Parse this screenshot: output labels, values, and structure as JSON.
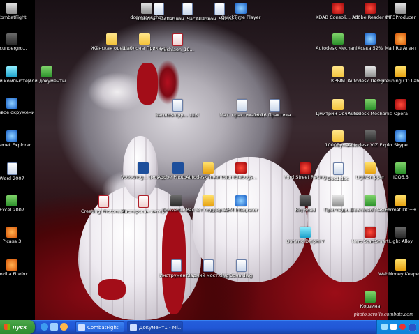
{
  "left_icons": [
    {
      "label": "CombatFight",
      "icon": "combatfight-icon",
      "cls": "i-gray"
    },
    {
      "label": "dcundergro...",
      "icon": "program-icon",
      "cls": "i-dark"
    },
    {
      "label": "Мой компьютер",
      "icon": "computer-icon",
      "cls": "i-cyan"
    },
    {
      "label": "Сетевое окружение",
      "icon": "network-icon",
      "cls": "i-blue"
    },
    {
      "label": "Internet Explorer",
      "icon": "ie-icon",
      "cls": "i-blue"
    },
    {
      "label": "Word 2007",
      "icon": "word-icon",
      "cls": "i-doc"
    },
    {
      "label": "Excel 2007",
      "icon": "excel-icon",
      "cls": "i-green"
    },
    {
      "label": "Picasa 3",
      "icon": "picasa-icon",
      "cls": "i-orange"
    },
    {
      "label": "Mozilla Firefox",
      "icon": "firefox-icon",
      "cls": "i-orange"
    }
  ],
  "middle_icons": [
    {
      "label": "dcdresser.chm",
      "icon": "help-file-icon",
      "cls": "i-gray"
    },
    {
      "label": "Шаблон. Часть 1.avi",
      "icon": "video-file-icon",
      "cls": "i-doc"
    },
    {
      "label": "Шаблон. Часть 2.avi",
      "icon": "video-file-icon",
      "cls": "i-doc"
    },
    {
      "label": "Шаблон. Часть 3.avi",
      "icon": "video-file-icon",
      "cls": "i-doc"
    },
    {
      "label": "QuickTime Player",
      "icon": "quicktime-icon",
      "cls": "i-blue"
    },
    {
      "label": "Мои документы",
      "icon": "my-documents-icon",
      "cls": "i-green"
    },
    {
      "label": "Жёнская одежда",
      "icon": "folder-icon",
      "cls": "i-folder"
    },
    {
      "label": "Шаблоны Приказов",
      "icon": "folder-icon",
      "cls": "i-folder"
    },
    {
      "label": "nuchlaon_19...",
      "icon": "pdf-icon",
      "cls": "i-pdf"
    },
    {
      "label": "NarutoShipp... 115 RusSub...",
      "icon": "video-file-icon",
      "cls": "i-doc"
    },
    {
      "label": "Мат. практика.doc",
      "icon": "word-doc-icon",
      "cls": "i-doc"
    },
    {
      "label": "16.16 Практика...",
      "icon": "word-doc-icon",
      "cls": "i-doc"
    },
    {
      "label": "Vodocnog... (мой диз...",
      "icon": "photoshop-icon",
      "cls": "i-ps"
    },
    {
      "label": "Adobe Photosho...",
      "icon": "photoshop-icon",
      "cls": "i-ps"
    },
    {
      "label": "Autodesk Inventor...",
      "icon": "inventor-icon",
      "cls": "i-yellow"
    },
    {
      "label": "Tumblebugs...",
      "icon": "game-icon",
      "cls": "i-red"
    },
    {
      "label": "Creating Photorealisti...",
      "icon": "pdf-icon",
      "cls": "i-pdf"
    },
    {
      "label": "Мастерская интерьера",
      "icon": "pdf-icon",
      "cls": "i-pdf"
    },
    {
      "label": "ConvertLive",
      "icon": "convert-icon",
      "cls": "i-dark"
    },
    {
      "label": "Расчет поддерж...",
      "icon": "calc-icon",
      "cls": "i-yellow"
    },
    {
      "label": "APM Integrator",
      "icon": "apm-icon",
      "cls": "i-blue"
    },
    {
      "label": "Инструмент...",
      "icon": "dwg-icon",
      "cls": "i-doc"
    },
    {
      "label": "Задний мост.dwg",
      "icon": "dwg-icon",
      "cls": "i-doc"
    },
    {
      "label": "Зона.dwg",
      "icon": "dwg-icon",
      "cls": "i-doc"
    }
  ],
  "right_icons": [
    {
      "label": "KDAB Consoli... 2008",
      "icon": "program-icon",
      "cls": "i-red"
    },
    {
      "label": "Adobe Reader 8",
      "icon": "adobe-reader-icon",
      "cls": "i-red"
    },
    {
      "label": "Autodesk Mechanic...",
      "icon": "autocad-icon",
      "cls": "i-green"
    },
    {
      "label": "Аська 52%",
      "icon": "icq-icon",
      "cls": "i-blue"
    },
    {
      "label": "КРЫМ",
      "icon": "folder-icon",
      "cls": "i-folder"
    },
    {
      "label": "Autodesk Design Review",
      "icon": "autodesk-icon",
      "cls": "i-gray"
    },
    {
      "label": "Дмитрий Овчинников",
      "icon": "folder-icon",
      "cls": "i-folder"
    },
    {
      "label": "Autodesk Mechanical...",
      "icon": "autodesk-icon",
      "cls": "i-green"
    },
    {
      "label": "1000Бумаг",
      "icon": "folder-icon",
      "cls": "i-folder"
    },
    {
      "label": "Autodesk VIZ Explorer 2008",
      "icon": "autodesk-icon",
      "cls": "i-dark"
    },
    {
      "label": "Ford Street Racing",
      "icon": "racing-game-icon",
      "cls": "i-red"
    },
    {
      "label": "Doc1.doc",
      "icon": "word-doc-icon",
      "cls": "i-doc"
    },
    {
      "label": "LightSnipper",
      "icon": "program-icon",
      "cls": "i-yellow"
    },
    {
      "label": "Big Road",
      "icon": "game-icon",
      "cls": "i-dark"
    },
    {
      "label": "Пригляди...",
      "icon": "program-icon",
      "cls": "i-gray"
    },
    {
      "label": "Download Master",
      "icon": "download-master-icon",
      "cls": "i-green"
    },
    {
      "label": "Borland Delphi 7",
      "icon": "delphi-icon",
      "cls": "i-cyan"
    },
    {
      "label": "Nero StartSmart",
      "icon": "nero-icon",
      "cls": "i-red"
    },
    {
      "label": "Корзина",
      "icon": "recycle-bin-icon",
      "cls": "i-green"
    }
  ],
  "far_right_icons": [
    {
      "label": "MP3Producer",
      "icon": "mp3-icon",
      "cls": "i-gray"
    },
    {
      "label": "Mail.Ru Агент",
      "icon": "mailru-agent-icon",
      "cls": "i-orange"
    },
    {
      "label": "SureThing CD Labeler Delu...",
      "icon": "cd-labeler-icon",
      "cls": "i-yellow"
    },
    {
      "label": "Opera",
      "icon": "opera-icon",
      "cls": "i-red"
    },
    {
      "label": "Skype",
      "icon": "skype-icon",
      "cls": "i-blue"
    },
    {
      "label": "ICQ6.5",
      "icon": "icq-icon",
      "cls": "i-green"
    },
    {
      "label": "Format DC++",
      "icon": "dcpp-icon",
      "cls": "i-yellow"
    },
    {
      "label": "Light Alloy",
      "icon": "light-alloy-icon",
      "cls": "i-dark"
    },
    {
      "label": "WebMoney Keeper Clas...",
      "icon": "webmoney-icon",
      "cls": "i-yellow"
    }
  ],
  "watermark": "photo.scrolls.combats.com",
  "taskbar": {
    "start_label": "пуск",
    "tasks": [
      {
        "label": "CombatFight",
        "active": false
      },
      {
        "label": "Документ1 - Mi...",
        "active": true
      }
    ]
  },
  "colors": {
    "taskbar_blue": "#245edb",
    "start_green": "#3c9a3c",
    "tray_blue": "#0f82d8"
  }
}
